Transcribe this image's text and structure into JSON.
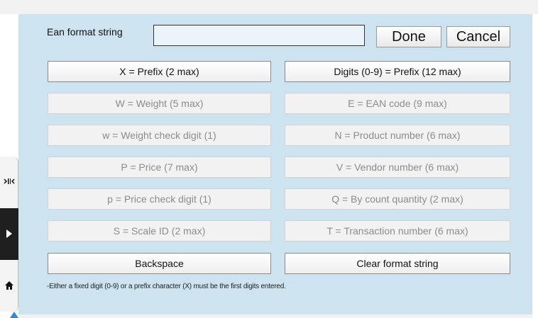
{
  "format_label": "Ean format string",
  "format_value": "",
  "done_label": "Done",
  "cancel_label": "Cancel",
  "buttons": [
    {
      "label": "X = Prefix (2 max)",
      "enabled": true
    },
    {
      "label": "Digits (0-9) = Prefix (12 max)",
      "enabled": true
    },
    {
      "label": "W = Weight (5 max)",
      "enabled": false
    },
    {
      "label": "E = EAN code (9 max)",
      "enabled": false
    },
    {
      "label": "w = Weight check digit (1)",
      "enabled": false
    },
    {
      "label": "N = Product number (6 max)",
      "enabled": false
    },
    {
      "label": "P = Price (7 max)",
      "enabled": false
    },
    {
      "label": "V = Vendor number (6 max)",
      "enabled": false
    },
    {
      "label": "p = Price check digit (1)",
      "enabled": false
    },
    {
      "label": "Q = By count quantity (2 max)",
      "enabled": false
    },
    {
      "label": "S = Scale ID (2 max)",
      "enabled": false
    },
    {
      "label": "T = Transaction number (6 max)",
      "enabled": false
    },
    {
      "label": "Backspace",
      "enabled": true
    },
    {
      "label": "Clear format string",
      "enabled": true
    }
  ],
  "note": "-Either a fixed digit (0-9) or a prefix character (X) must be the first digits entered.",
  "sidebar": {
    "icons": [
      "scale-code-icon",
      "play-arrow-icon",
      "home-icon"
    ]
  }
}
